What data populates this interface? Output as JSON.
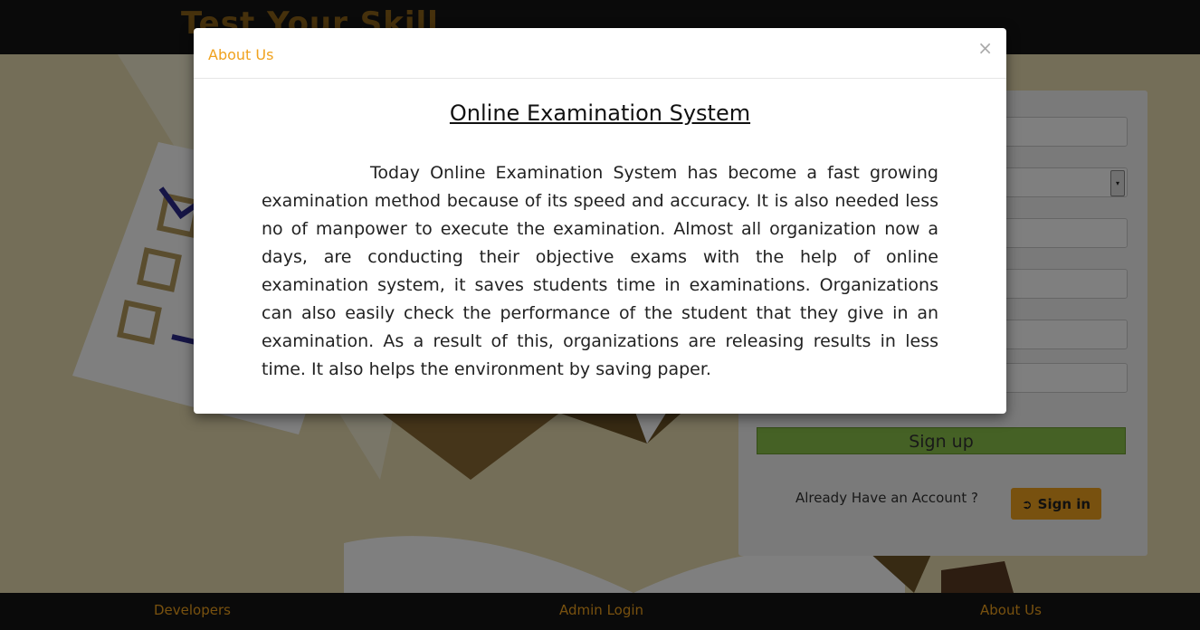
{
  "header": {
    "brand": "Test Your Skill"
  },
  "signup": {
    "select_arrow": "▾",
    "signup_label": "Sign up",
    "already_text": "Already Have an Account ?",
    "signin_label": "Sign in"
  },
  "footer": {
    "developers": "Developers",
    "admin_login": "Admin Login",
    "about_us": "About Us"
  },
  "modal": {
    "title": "About Us",
    "close": "×",
    "heading": "Online Examination System",
    "body": "Today Online Examination System has become a fast growing examination method because of its speed and accuracy. It is also needed less no of manpower to execute the examination. Almost all organization now a days, are conducting their objective exams with the help of online examination system, it saves students time in examinations. Organizations can also easily check the performance of the student that they give in an examination. As a result of this, organizations are releasing results in less time. It also helps the environment by saving paper."
  },
  "colors": {
    "accent": "#f0a21e",
    "signup_green": "#8bc34a",
    "dark_bar": "#141414"
  }
}
